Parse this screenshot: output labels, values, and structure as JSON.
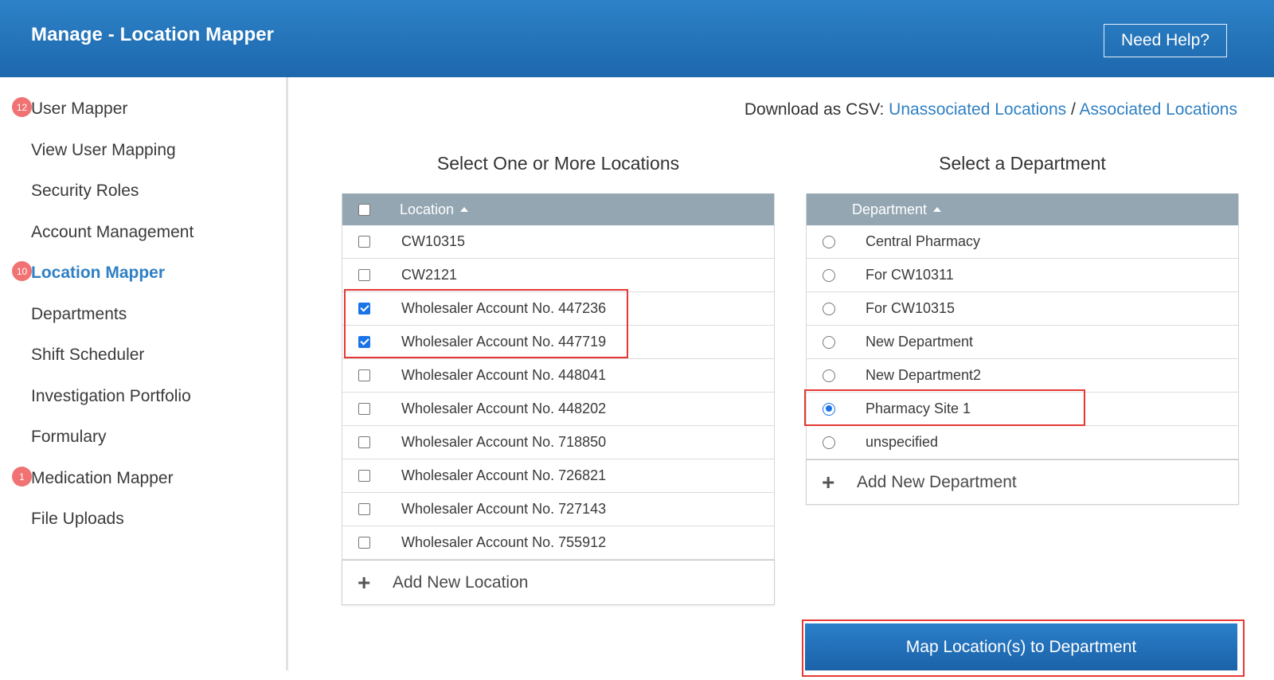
{
  "header": {
    "title": "Manage - Location Mapper",
    "help_label": "Need Help?"
  },
  "sidebar": {
    "items": [
      {
        "label": "User Mapper",
        "badge": "12",
        "active": false
      },
      {
        "label": "View User Mapping",
        "badge": "",
        "active": false
      },
      {
        "label": "Security Roles",
        "badge": "",
        "active": false
      },
      {
        "label": "Account Management",
        "badge": "",
        "active": false
      },
      {
        "label": "Location Mapper",
        "badge": "10",
        "active": true
      },
      {
        "label": "Departments",
        "badge": "",
        "active": false
      },
      {
        "label": "Shift Scheduler",
        "badge": "",
        "active": false
      },
      {
        "label": "Investigation Portfolio",
        "badge": "",
        "active": false
      },
      {
        "label": "Formulary",
        "badge": "",
        "active": false
      },
      {
        "label": "Medication Mapper",
        "badge": "1",
        "active": false
      },
      {
        "label": "File Uploads",
        "badge": "",
        "active": false
      }
    ]
  },
  "csv": {
    "prefix": "Download as CSV:",
    "unassociated": "Unassociated Locations",
    "separator": "/",
    "associated": "Associated Locations"
  },
  "locations": {
    "title": "Select One or More Locations",
    "header": "Location",
    "rows": [
      {
        "label": "CW10315",
        "checked": false
      },
      {
        "label": "CW2121",
        "checked": false
      },
      {
        "label": "Wholesaler Account No. 447236",
        "checked": true
      },
      {
        "label": "Wholesaler Account No. 447719",
        "checked": true
      },
      {
        "label": "Wholesaler Account No. 448041",
        "checked": false
      },
      {
        "label": "Wholesaler Account No. 448202",
        "checked": false
      },
      {
        "label": "Wholesaler Account No. 718850",
        "checked": false
      },
      {
        "label": "Wholesaler Account No. 726821",
        "checked": false
      },
      {
        "label": "Wholesaler Account No. 727143",
        "checked": false
      },
      {
        "label": "Wholesaler Account No. 755912",
        "checked": false
      }
    ],
    "add_label": "Add New Location"
  },
  "departments": {
    "title": "Select a Department",
    "header": "Department",
    "rows": [
      {
        "label": "Central Pharmacy",
        "selected": false
      },
      {
        "label": "For CW10311",
        "selected": false
      },
      {
        "label": "For CW10315",
        "selected": false
      },
      {
        "label": "New Department",
        "selected": false
      },
      {
        "label": "New Department2",
        "selected": false
      },
      {
        "label": "Pharmacy Site 1",
        "selected": true
      },
      {
        "label": "unspecified",
        "selected": false
      }
    ],
    "add_label": "Add New Department"
  },
  "actions": {
    "map_label": "Map Location(s) to Department"
  },
  "colors": {
    "header_blue": "#1d67ad",
    "link_blue": "#2f80c4",
    "badge_red": "#f07272",
    "highlight_red": "#e53935",
    "grid_header": "#94a6b2"
  }
}
